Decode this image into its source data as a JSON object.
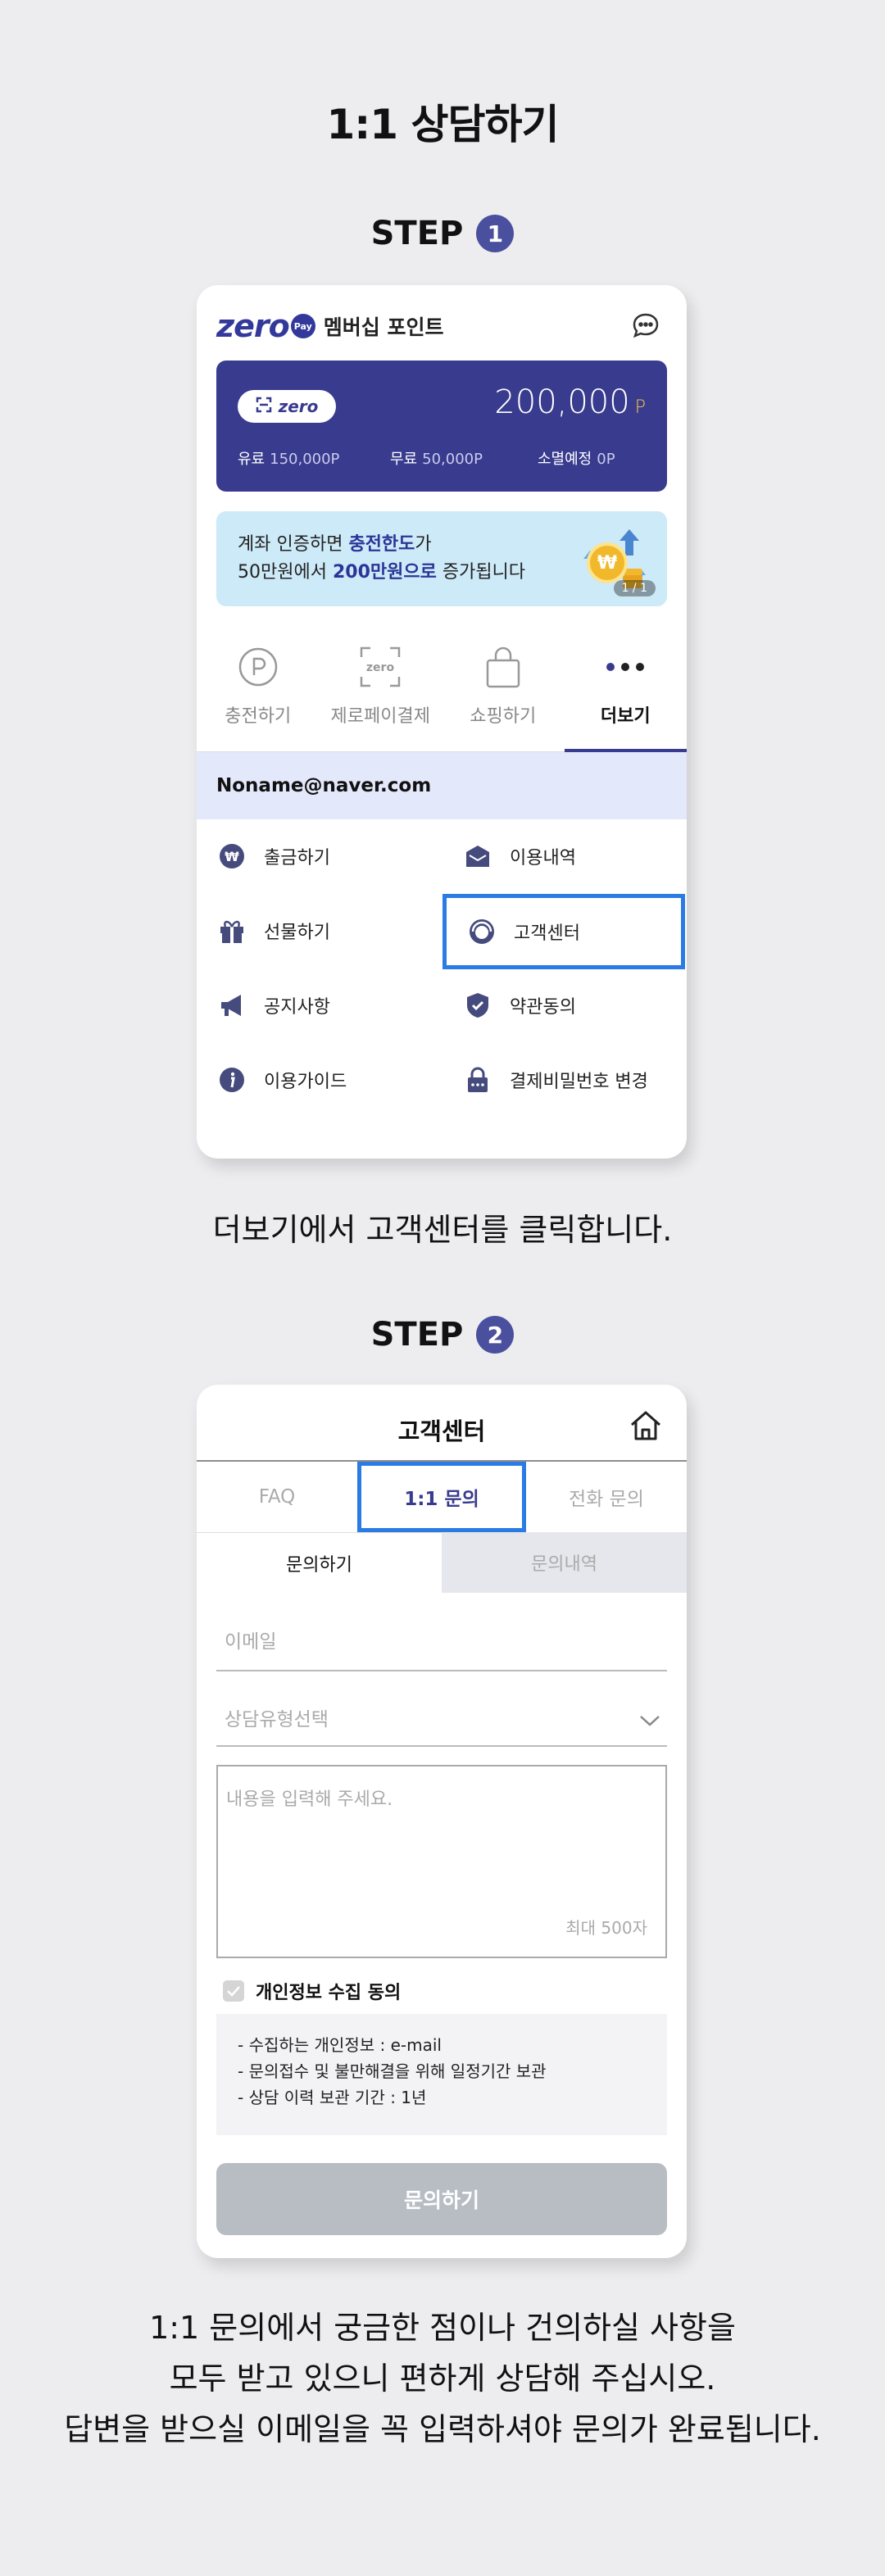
{
  "page_title": "1:1 상담하기",
  "step1": {
    "label": "STEP",
    "number": "1",
    "phone": {
      "brand": "zero",
      "brand_badge": "Pay",
      "header_title": "멤버십 포인트",
      "card": {
        "pill_label": "zero",
        "balance": "200,000",
        "balance_unit": "P",
        "paid_label": "유료",
        "paid_value": "150,000P",
        "free_label": "무료",
        "free_value": "50,000P",
        "expire_label": "소멸예정",
        "expire_value": "0P"
      },
      "banner": {
        "line1_a": "계좌 인증하면 ",
        "line1_hl": "충전한도",
        "line1_b": "가",
        "line2_a": "50만원에서 ",
        "line2_hl": "200만원으로",
        "line2_b": " 증가됩니다",
        "coin_symbol": "₩",
        "page": "1 / 1"
      },
      "tabs": [
        {
          "label": "충전하기",
          "icon": "point-circle-icon"
        },
        {
          "label": "제로페이결제",
          "icon": "zero-scan-icon"
        },
        {
          "label": "쇼핑하기",
          "icon": "shopping-bag-icon"
        },
        {
          "label": "더보기",
          "icon": "more-dots-icon",
          "active": true
        }
      ],
      "email": "Noname@naver.com",
      "menu": [
        {
          "label": "출금하기",
          "icon": "withdraw-icon"
        },
        {
          "label": "이용내역",
          "icon": "history-icon"
        },
        {
          "label": "선물하기",
          "icon": "gift-icon"
        },
        {
          "label": "고객센터",
          "icon": "customer-center-icon",
          "highlighted": true
        },
        {
          "label": "공지사항",
          "icon": "megaphone-icon"
        },
        {
          "label": "약관동의",
          "icon": "shield-check-icon"
        },
        {
          "label": "이용가이드",
          "icon": "info-icon"
        },
        {
          "label": "결제비밀번호 변경",
          "icon": "lock-icon"
        }
      ]
    },
    "caption": "더보기에서 고객센터를 클릭합니다."
  },
  "step2": {
    "label": "STEP",
    "number": "2",
    "phone": {
      "title": "고객센터",
      "tabs": [
        {
          "label": "FAQ"
        },
        {
          "label": "1:1 문의",
          "active": true
        },
        {
          "label": "전화 문의"
        }
      ],
      "subtabs": [
        {
          "label": "문의하기",
          "active": true
        },
        {
          "label": "문의내역"
        }
      ],
      "email_placeholder": "이메일",
      "type_placeholder": "상담유형선택",
      "content_placeholder": "내용을 입력해 주세요.",
      "max_length": "최대 500자",
      "agree_label": "개인정보 수집 동의",
      "info_lines": [
        "- 수집하는 개인정보 : e-mail",
        "- 문의접수 및 불만해결을 위해 일정기간 보관",
        "- 상담 이력 보관 기간  : 1년"
      ],
      "submit_label": "문의하기"
    },
    "caption_lines": [
      "1:1 문의에서 궁금한 점이나 건의하실 사항을",
      "모두 받고 있으니 편하게 상담해 주십시오.",
      "답변을 받으실 이메일을 꼭 입력하셔야 문의가 완료됩니다."
    ]
  },
  "colors": {
    "background": "#ededf0",
    "brand_navy": "#393b8e",
    "highlight_blue": "#2a7be4",
    "banner_bg": "#cdeaf8",
    "email_row_bg": "#e4e8fb",
    "disabled_button": "#b8bcc3"
  }
}
